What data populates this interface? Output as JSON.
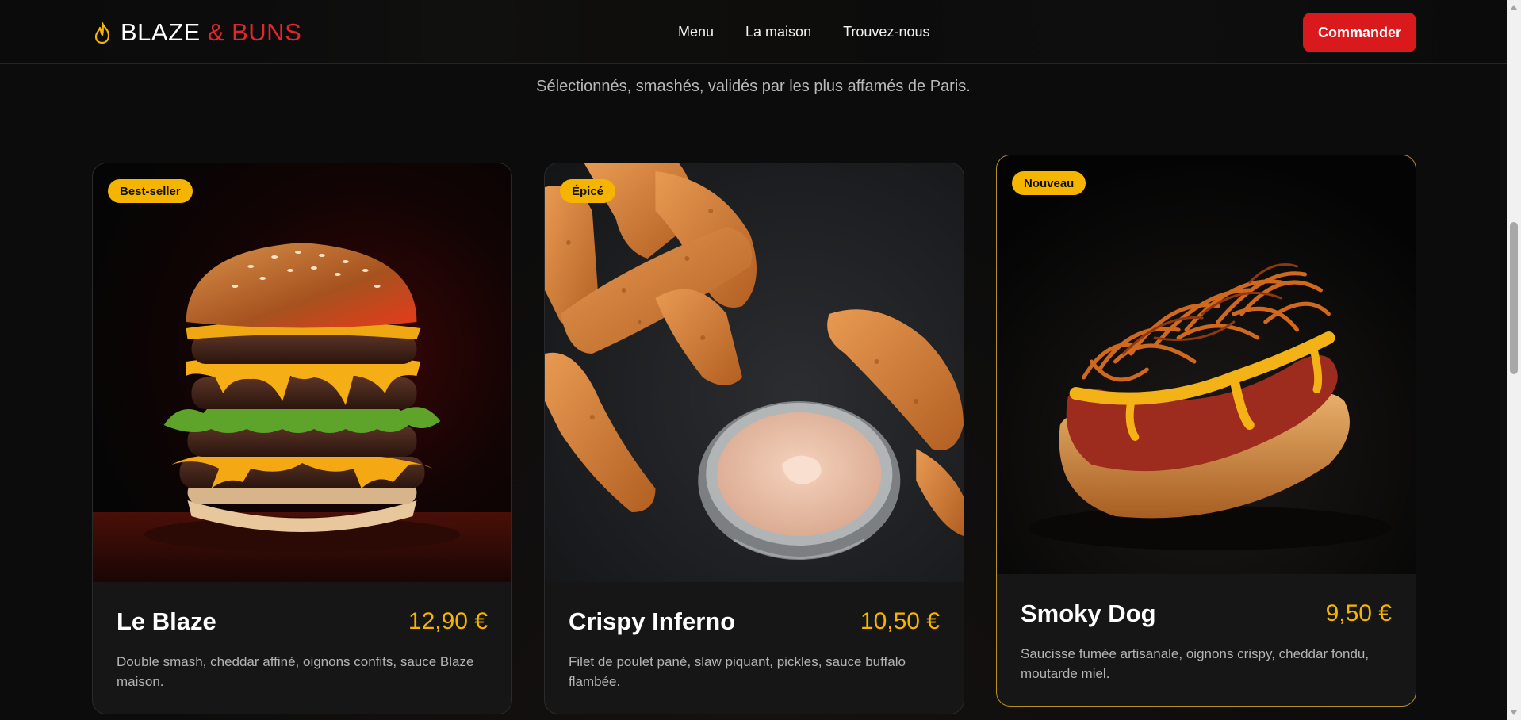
{
  "brand": {
    "name_first": "BLAZE",
    "name_amp": " & BUNS",
    "icon": "flame-icon"
  },
  "nav": {
    "links": [
      "Menu",
      "La maison",
      "Trouvez-nous"
    ],
    "cta_label": "Commander"
  },
  "section": {
    "subtitle": "Sélectionnés, smashés, validés par les plus affamés de Paris."
  },
  "products": [
    {
      "badge": "Best-seller",
      "title": "Le Blaze",
      "price": "12,90 €",
      "description": "Double smash, cheddar affiné, oignons confits, sauce Blaze maison."
    },
    {
      "badge": "Épicé",
      "title": "Crispy Inferno",
      "price": "10,50 €",
      "description": "Filet de poulet pané, slaw piquant, pickles, sauce buffalo flambée."
    },
    {
      "badge": "Nouveau",
      "title": "Smoky Dog",
      "price": "9,50 €",
      "description": "Saucisse fumée artisanale, oignons crispy, cheddar fondu, moutarde miel."
    }
  ],
  "colors": {
    "accent_red": "#d9191b",
    "accent_gold": "#f5b400",
    "background": "#0c0c0c"
  }
}
